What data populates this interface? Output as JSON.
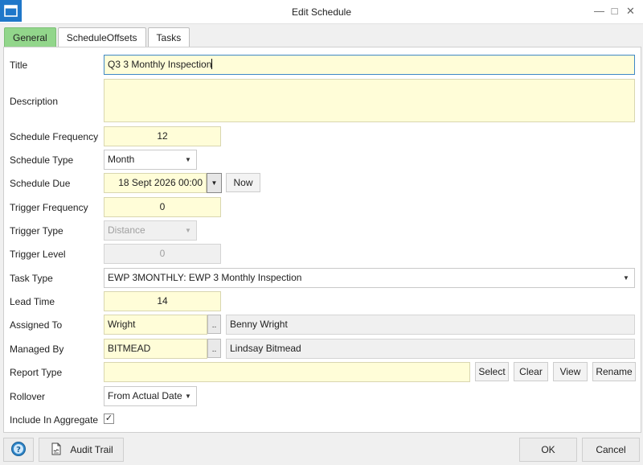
{
  "window": {
    "title": "Edit Schedule",
    "controls": {
      "minimize": "—",
      "maximize": "□",
      "close": "✕"
    }
  },
  "tabs": [
    {
      "label": "General",
      "active": true
    },
    {
      "label": "ScheduleOffsets",
      "active": false
    },
    {
      "label": "Tasks",
      "active": false
    }
  ],
  "form": {
    "title": {
      "label": "Title",
      "value": "Q3 3 Monthly Inspection"
    },
    "description": {
      "label": "Description",
      "value": ""
    },
    "schedule_frequency": {
      "label": "Schedule Frequency",
      "value": "12"
    },
    "schedule_type": {
      "label": "Schedule Type",
      "value": "Month"
    },
    "schedule_due": {
      "label": "Schedule Due",
      "value": "18 Sept 2026 00:00",
      "now_label": "Now"
    },
    "trigger_frequency": {
      "label": "Trigger Frequency",
      "value": "0"
    },
    "trigger_type": {
      "label": "Trigger Type",
      "value": "Distance"
    },
    "trigger_level": {
      "label": "Trigger Level",
      "value": "0"
    },
    "task_type": {
      "label": "Task Type",
      "value": "EWP 3MONTHLY: EWP 3 Monthly Inspection"
    },
    "lead_time": {
      "label": "Lead Time",
      "value": "14"
    },
    "assigned_to": {
      "label": "Assigned To",
      "code": "Wright",
      "name": "Benny Wright",
      "browse": ".."
    },
    "managed_by": {
      "label": "Managed By",
      "code": "BITMEAD",
      "name": "Lindsay Bitmead",
      "browse": ".."
    },
    "report_type": {
      "label": "Report Type",
      "value": "",
      "buttons": {
        "select": "Select",
        "clear": "Clear",
        "view": "View",
        "rename": "Rename"
      }
    },
    "rollover": {
      "label": "Rollover",
      "value": "From Actual Date"
    },
    "include_in_aggregate": {
      "label": "Include In Aggregate",
      "checked": true,
      "mark": "✓"
    }
  },
  "footer": {
    "audit_trail": "Audit Trail",
    "ok": "OK",
    "cancel": "Cancel"
  },
  "icons": {
    "app": "window-icon",
    "help": "help-icon",
    "audit": "document-signature-icon",
    "dropdown": "chevron-down-icon"
  },
  "colors": {
    "active_tab": "#92d68b",
    "input_background": "#fffdd8",
    "focus_border": "#3f88c5",
    "app_icon": "#1f77c9"
  }
}
